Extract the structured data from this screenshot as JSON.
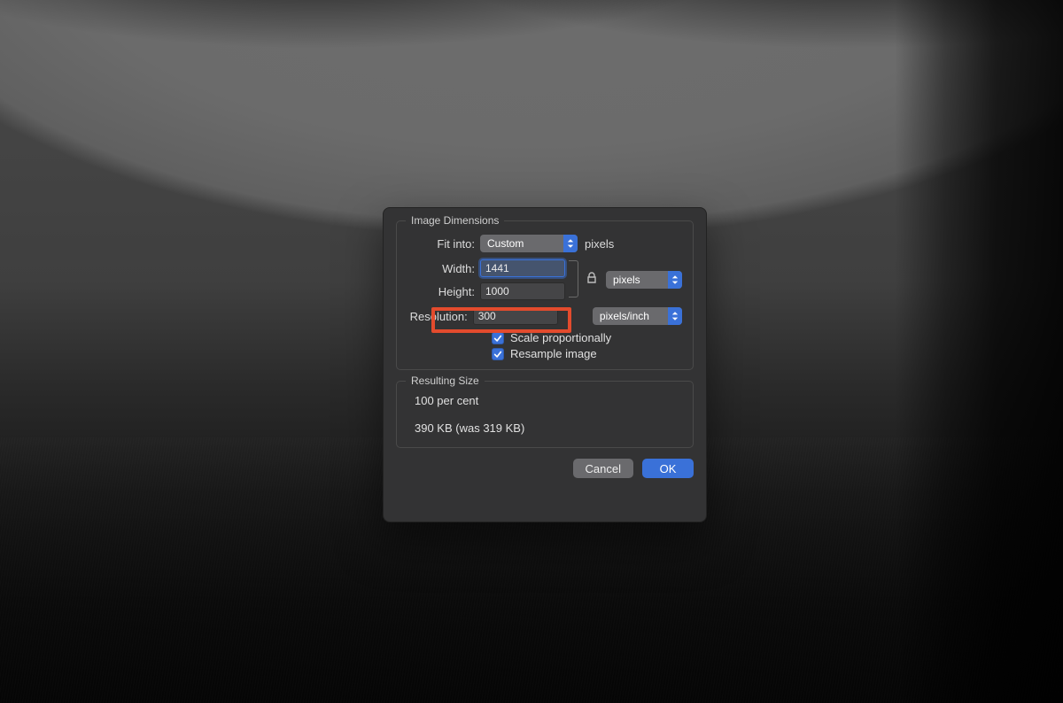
{
  "dialog": {
    "sections": {
      "dimensions": {
        "legend": "Image Dimensions",
        "fit_into_label": "Fit into:",
        "fit_into_value": "Custom",
        "fit_into_unit": "pixels",
        "width_label": "Width:",
        "width_value": "1441",
        "height_label": "Height:",
        "height_value": "1000",
        "size_unit_value": "pixels",
        "resolution_label": "Resolution:",
        "resolution_value": "300",
        "resolution_unit_value": "pixels/inch",
        "scale_label": "Scale proportionally",
        "resample_label": "Resample image"
      },
      "result": {
        "legend": "Resulting Size",
        "percent_line": "100 per cent",
        "size_line": "390 KB (was 319 KB)"
      }
    },
    "buttons": {
      "cancel": "Cancel",
      "ok": "OK"
    }
  }
}
